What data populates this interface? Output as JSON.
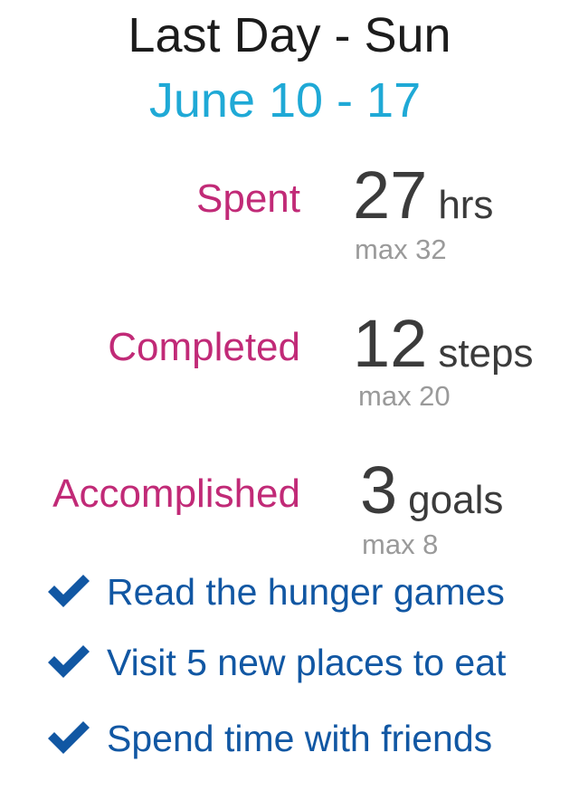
{
  "header": {
    "title": "Last Day - Sun",
    "subtitle": "June 10 - 17"
  },
  "stats": [
    {
      "label": "Spent",
      "value": "27",
      "unit": "hrs",
      "max": "max 32"
    },
    {
      "label": "Completed",
      "value": "12",
      "unit": "steps",
      "max": "max 20"
    },
    {
      "label": "Accomplished",
      "value": "3",
      "unit": "goals",
      "max": "max 8"
    }
  ],
  "goals": [
    {
      "icon": "checkmark-icon",
      "text": "Read the hunger games"
    },
    {
      "icon": "checkmark-icon",
      "text": "Visit 5 new places to eat"
    },
    {
      "icon": "checkmark-icon",
      "text": "Spend time with friends"
    }
  ],
  "colors": {
    "title": "#1c1c1c",
    "subtitle": "#1fa9d6",
    "label": "#c12a77",
    "value": "#3b3b3b",
    "max": "#9a9a9a",
    "goal": "#1157a3"
  }
}
